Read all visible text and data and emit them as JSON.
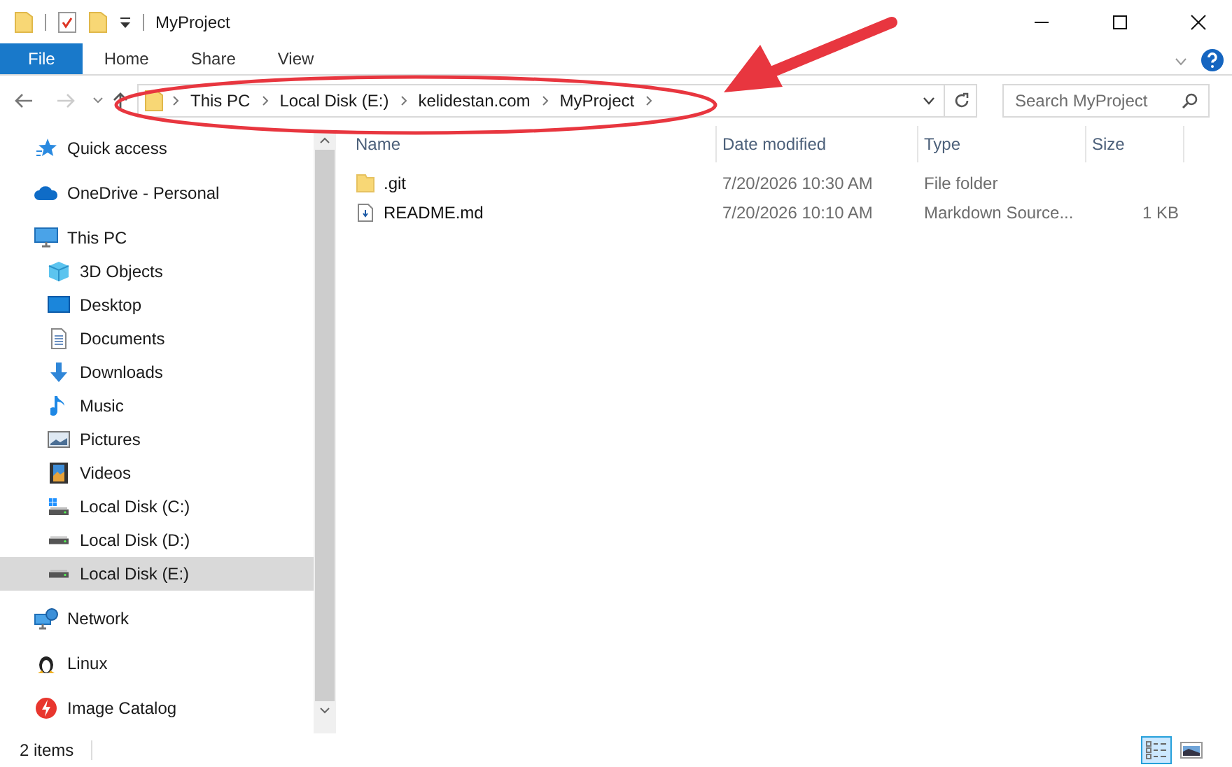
{
  "window": {
    "title": "MyProject"
  },
  "ribbon_tabs": [
    {
      "label": "File",
      "selected": true
    },
    {
      "label": "Home",
      "selected": false
    },
    {
      "label": "Share",
      "selected": false
    },
    {
      "label": "View",
      "selected": false
    }
  ],
  "address_bar": {
    "segments": [
      "This PC",
      "Local Disk (E:)",
      "kelidestan.com",
      "MyProject"
    ]
  },
  "search": {
    "placeholder": "Search MyProject"
  },
  "sidebar": {
    "items": [
      {
        "label": "Quick access",
        "selected": false
      },
      {
        "label": "OneDrive - Personal",
        "selected": false
      },
      {
        "label": "This PC",
        "selected": false,
        "children": [
          {
            "label": "3D Objects",
            "selected": false
          },
          {
            "label": "Desktop",
            "selected": false
          },
          {
            "label": "Documents",
            "selected": false
          },
          {
            "label": "Downloads",
            "selected": false
          },
          {
            "label": "Music",
            "selected": false
          },
          {
            "label": "Pictures",
            "selected": false
          },
          {
            "label": "Videos",
            "selected": false
          },
          {
            "label": "Local Disk (C:)",
            "selected": false
          },
          {
            "label": "Local Disk (D:)",
            "selected": false
          },
          {
            "label": "Local Disk (E:)",
            "selected": true
          }
        ]
      },
      {
        "label": "Network",
        "selected": false
      },
      {
        "label": "Linux",
        "selected": false
      },
      {
        "label": "Image Catalog",
        "selected": false
      }
    ]
  },
  "table": {
    "columns": [
      "Name",
      "Date modified",
      "Type",
      "Size"
    ],
    "rows": [
      {
        "kind": "folder",
        "name": ".git",
        "date_modified": "7/20/2026 10:30 AM",
        "type": "File folder"
      },
      {
        "kind": "file",
        "name": "README.md",
        "date_modified": "7/20/2026 10:10 AM",
        "type": "Markdown Source...",
        "size": "1 KB"
      }
    ]
  },
  "status_bar": {
    "item_count": "2 items",
    "views": [
      {
        "kind": "details",
        "selected": true
      },
      {
        "kind": "large_icons",
        "selected": false
      }
    ]
  }
}
